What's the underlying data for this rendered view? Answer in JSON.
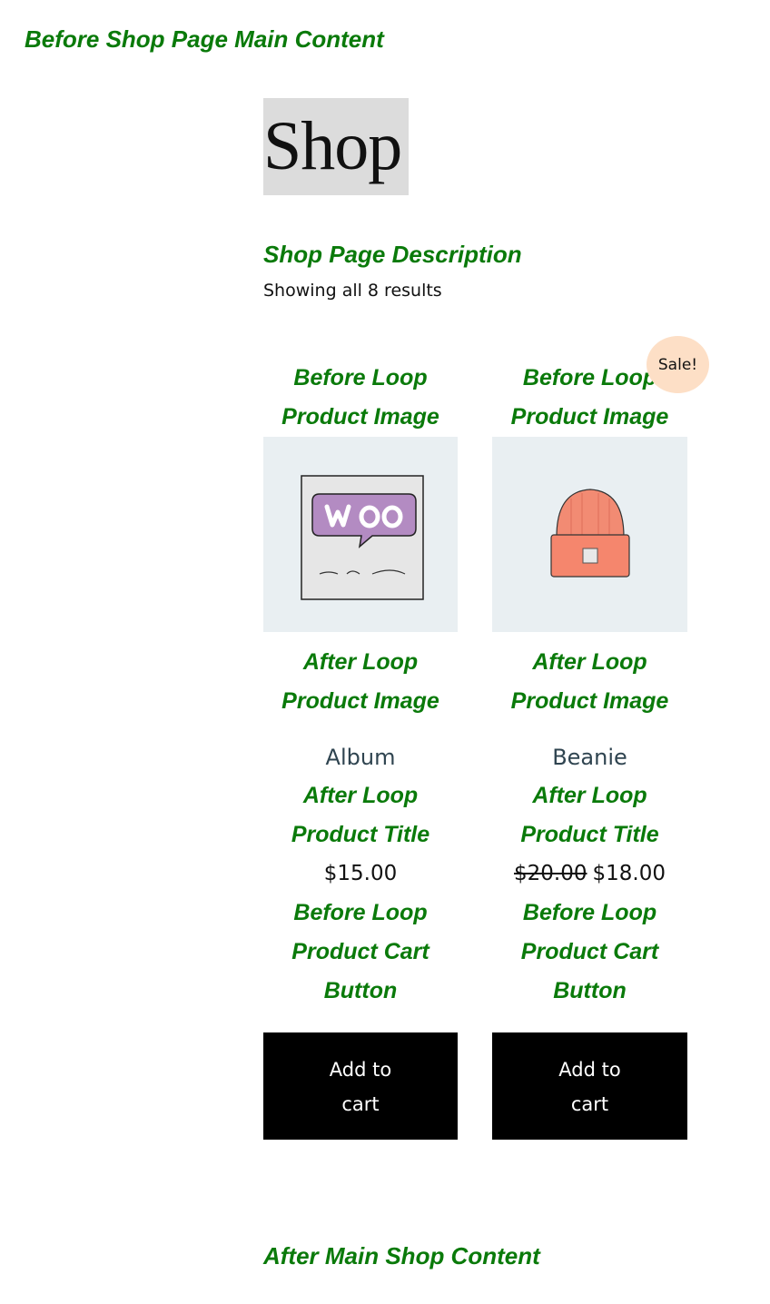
{
  "hooks": {
    "before_main": "Before Shop Page Main Content",
    "shop_description": "Shop Page Description",
    "after_main": "After Main Shop Content"
  },
  "page": {
    "title": "Shop",
    "result_count": "Showing all 8 results"
  },
  "products": [
    {
      "before_image_line1": "Before Loop",
      "before_image_line2": "Product Image",
      "image_icon": "woo-album-icon",
      "after_image_line1": "After Loop",
      "after_image_line2": "Product Image",
      "title": "Album",
      "after_title_line1": "After Loop",
      "after_title_line2": "Product Title",
      "price": "$15.00",
      "before_cart_line1": "Before Loop",
      "before_cart_line2": "Product Cart",
      "before_cart_line3": "Button",
      "button_label": "Add to cart"
    },
    {
      "before_image_line1": "Before Loop",
      "before_image_line2": "Product Image",
      "image_icon": "beanie-icon",
      "sale_badge": "Sale!",
      "after_image_line1": "After Loop",
      "after_image_line2": "Product Image",
      "title": "Beanie",
      "after_title_line1": "After Loop",
      "after_title_line2": "Product Title",
      "regular_price": "$20.00",
      "sale_price": "$18.00",
      "before_cart_line1": "Before Loop",
      "before_cart_line2": "Product Cart",
      "before_cart_line3": "Button",
      "button_label": "Add to cart"
    }
  ],
  "colors": {
    "hook_text": "#0a7a0a",
    "title_bg": "#dcdcdc",
    "thumb_bg": "#e9eff2",
    "sale_badge_bg": "#fddfc6",
    "button_bg": "#000000",
    "button_text": "#ffffff",
    "product_title": "#2f4450"
  }
}
